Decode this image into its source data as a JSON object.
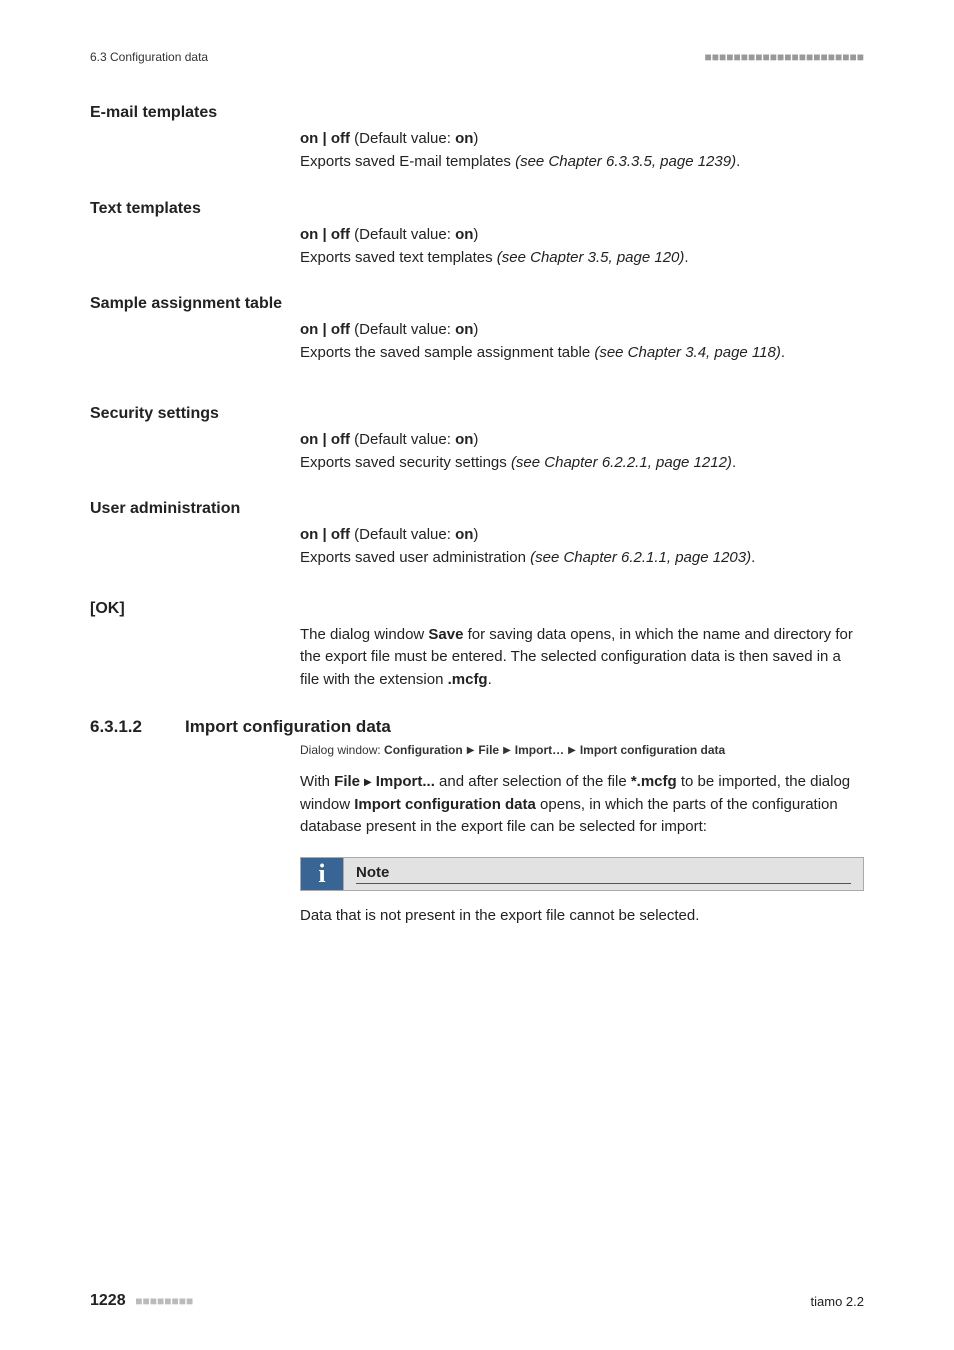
{
  "runhead": {
    "left": "6.3 Configuration data",
    "rightDots": "■■■■■■■■■■■■■■■■■■■■■■"
  },
  "sections": {
    "email": {
      "label": "E-mail templates",
      "onoff_prefix": "on | off",
      "default_label": " (Default value: ",
      "default_value": "on",
      "default_suffix": ")",
      "desc_a": "Exports saved E-mail templates ",
      "desc_it": "(see Chapter 6.3.3.5, page 1239)",
      "desc_b": "."
    },
    "text": {
      "label": "Text templates",
      "onoff_prefix": "on | off",
      "default_label": " (Default value: ",
      "default_value": "on",
      "default_suffix": ")",
      "desc_a": "Exports saved text templates ",
      "desc_it": "(see Chapter 3.5, page 120)",
      "desc_b": "."
    },
    "sample": {
      "label": "Sample assignment table",
      "onoff_prefix": "on | off",
      "default_label": " (Default value: ",
      "default_value": "on",
      "default_suffix": ")",
      "desc_a": "Exports the saved sample assignment table ",
      "desc_it": "(see Chapter 3.4, page 118)",
      "desc_b": "."
    },
    "security": {
      "label": "Security settings",
      "onoff_prefix": "on | off",
      "default_label": " (Default value: ",
      "default_value": "on",
      "default_suffix": ")",
      "desc_a": "Exports saved security settings ",
      "desc_it": "(see Chapter 6.2.2.1, page 1212)",
      "desc_b": "."
    },
    "useradmin": {
      "label": "User administration",
      "onoff_prefix": "on | off",
      "default_label": " (Default value: ",
      "default_value": "on",
      "default_suffix": ")",
      "desc_a": "Exports saved user administration ",
      "desc_it": "(see Chapter 6.2.1.1, page 1203)",
      "desc_b": "."
    }
  },
  "ok": {
    "label": "[OK]",
    "p1a": "The dialog window ",
    "p1b": "Save",
    "p1c": " for saving data opens, in which the name and directory for the export file must be entered. The selected configuration data is then saved in a file with the extension ",
    "p1d": ".mcfg",
    "p1e": "."
  },
  "subsection": {
    "num": "6.3.1.2",
    "title": "Import configuration data",
    "dialog_prefix": "Dialog window: ",
    "dialog_b1": "Configuration",
    "dialog_b2": "File",
    "dialog_b3": "Import…",
    "dialog_b4": "Import configuration data",
    "para_a": "With ",
    "para_b": "File",
    "para_c": "Import...",
    "para_d": " and after selection of the file ",
    "para_e": "*.mcfg",
    "para_f": " to be imported, the dialog window ",
    "para_g": "Import configuration data",
    "para_h": " opens, in which the parts of the configuration database present in the export file can be selected for import:"
  },
  "note": {
    "title": "Note",
    "body": "Data that is not present in the export file cannot be selected."
  },
  "footer": {
    "page": "1228",
    "dots": "■■■■■■■■",
    "product": "tiamo 2.2"
  }
}
